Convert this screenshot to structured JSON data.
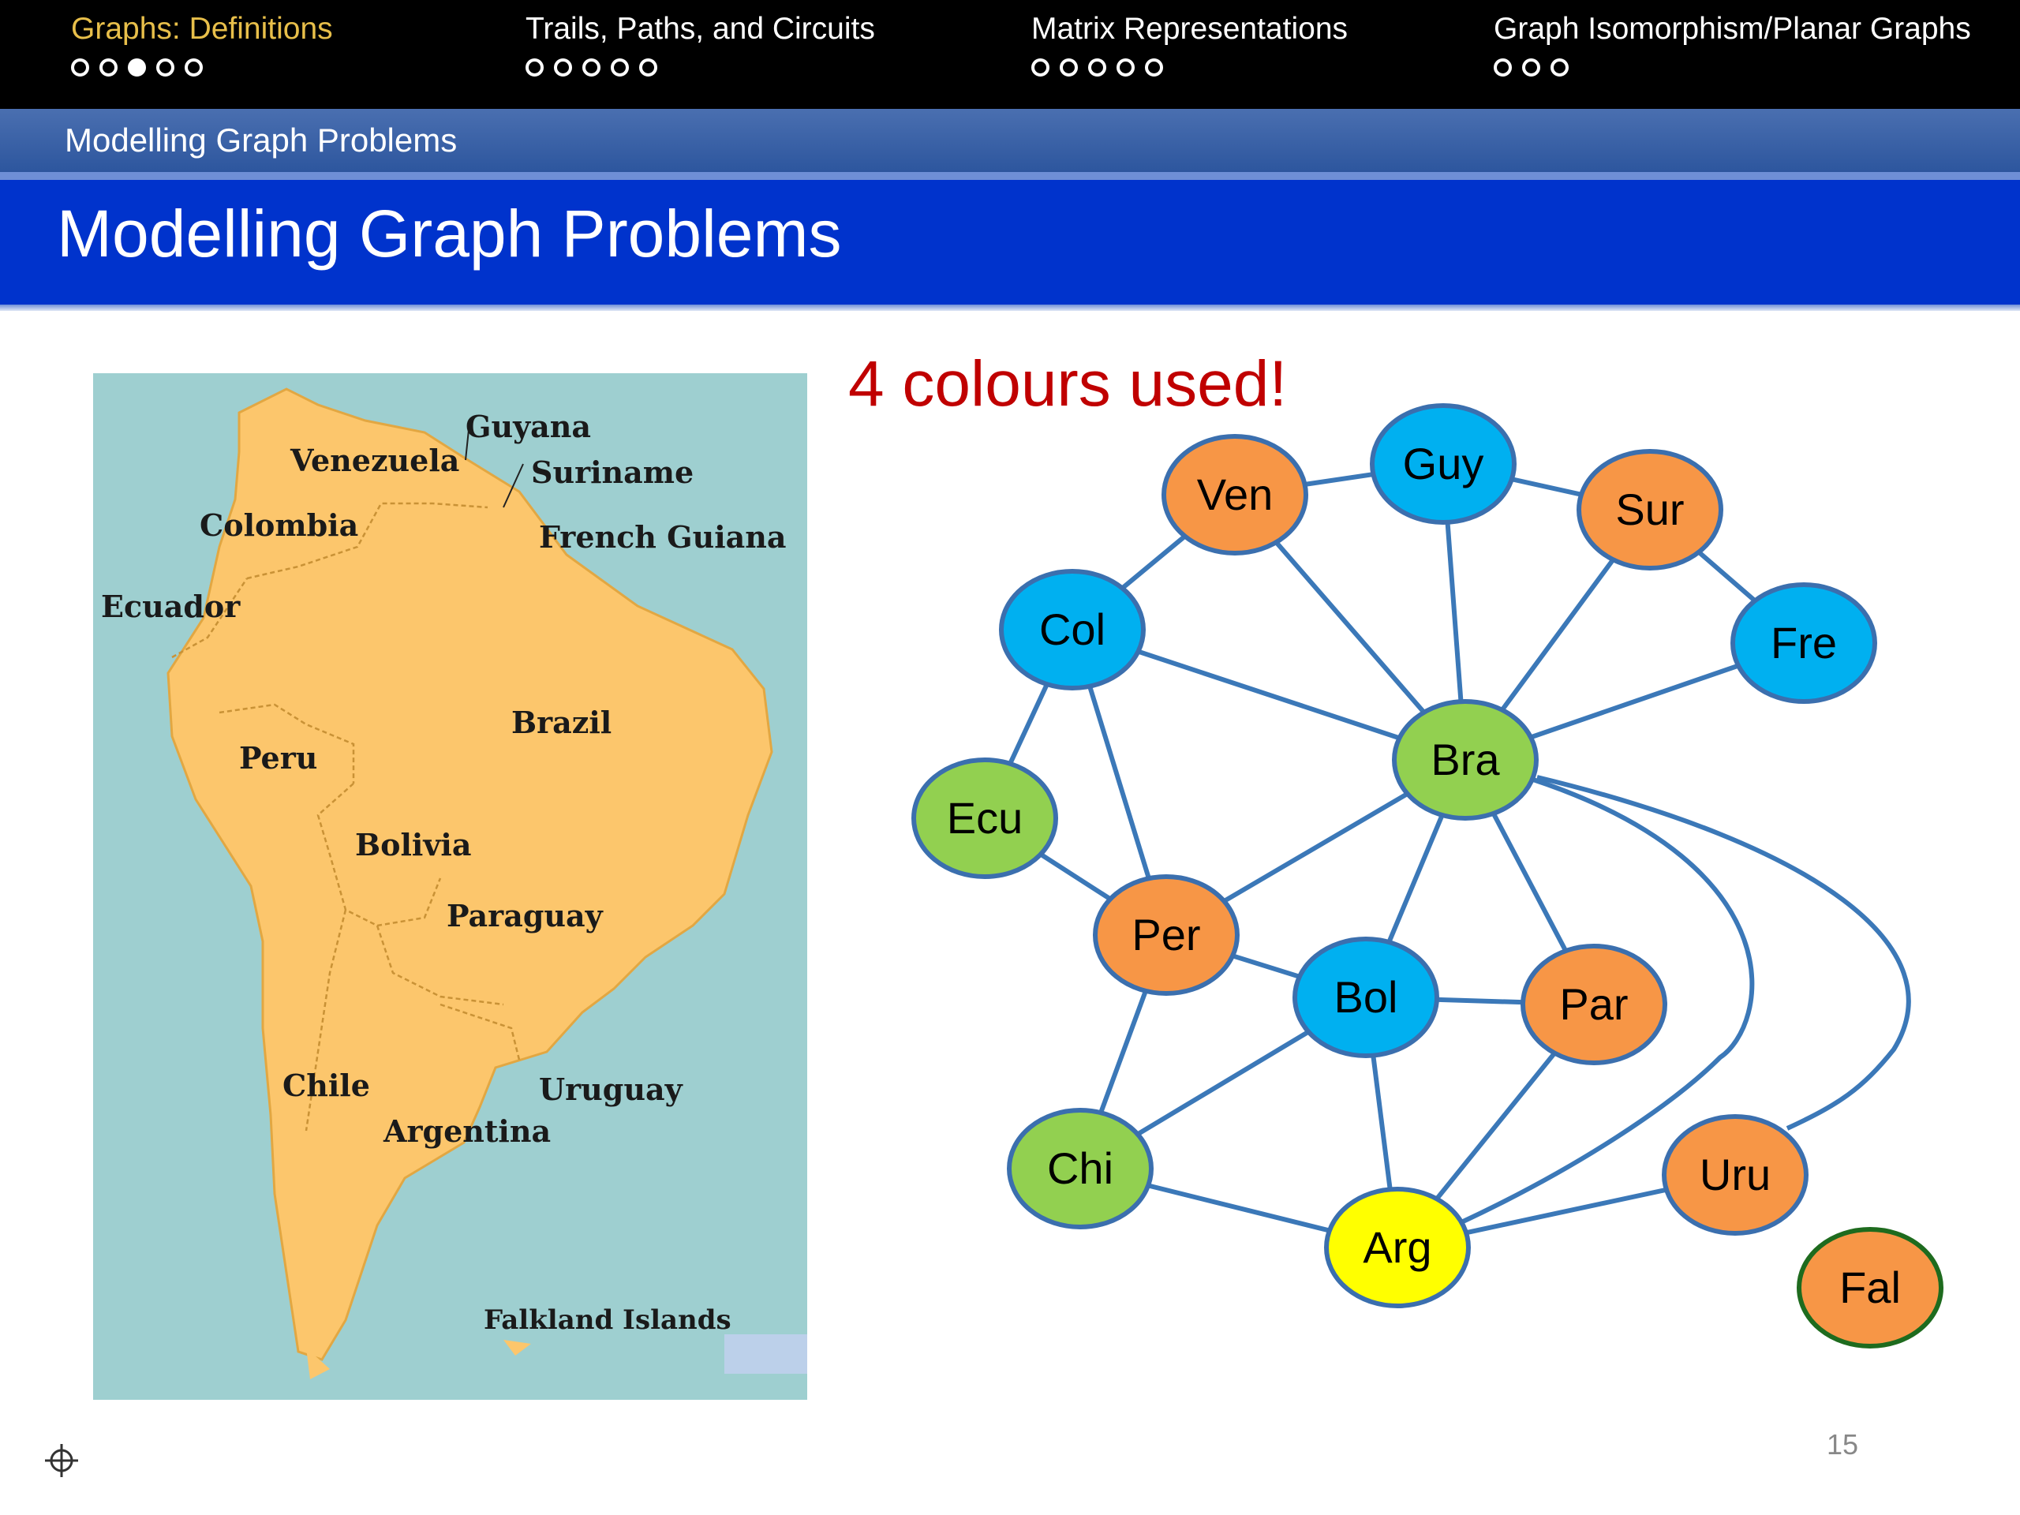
{
  "nav": {
    "sections": [
      {
        "title": "Graphs: Definitions",
        "dots": [
          false,
          false,
          true,
          false,
          false
        ],
        "active": true
      },
      {
        "title": "Trails, Paths, and Circuits",
        "dots": [
          false,
          false,
          false,
          false,
          false
        ],
        "active": false
      },
      {
        "title": "Matrix Representations",
        "dots": [
          false,
          false,
          false,
          false,
          false
        ],
        "active": false
      },
      {
        "title": "Graph Isomorphism/Planar Graphs",
        "dots": [
          false,
          false,
          false
        ],
        "active": false
      }
    ]
  },
  "subtitle": "Modelling Graph Problems",
  "title": "Modelling Graph Problems",
  "caption": "4 colours used!",
  "map": {
    "labels": {
      "guyana": "Guyana",
      "venezuela": "Venezuela",
      "suriname": "Suriname",
      "colombia": "Colombia",
      "french_guiana": "French Guiana",
      "ecuador": "Ecuador",
      "brazil": "Brazil",
      "peru": "Peru",
      "bolivia": "Bolivia",
      "paraguay": "Paraguay",
      "chile": "Chile",
      "uruguay": "Uruguay",
      "argentina": "Argentina",
      "falkland": "Falkland Islands"
    }
  },
  "graph": {
    "colors": {
      "orange": "#f79646",
      "blue": "#00b0f0",
      "green": "#92d050",
      "yellow": "#ffff00",
      "edge": "#3b78b8",
      "outline": "#3b6fae",
      "outline_fal": "#1e6b1e"
    },
    "nodes": [
      {
        "id": "ven",
        "label": "Ven",
        "color": "orange"
      },
      {
        "id": "guy",
        "label": "Guy",
        "color": "blue"
      },
      {
        "id": "sur",
        "label": "Sur",
        "color": "orange"
      },
      {
        "id": "col",
        "label": "Col",
        "color": "blue"
      },
      {
        "id": "fre",
        "label": "Fre",
        "color": "blue"
      },
      {
        "id": "bra",
        "label": "Bra",
        "color": "green"
      },
      {
        "id": "ecu",
        "label": "Ecu",
        "color": "green"
      },
      {
        "id": "per",
        "label": "Per",
        "color": "orange"
      },
      {
        "id": "bol",
        "label": "Bol",
        "color": "blue"
      },
      {
        "id": "par",
        "label": "Par",
        "color": "orange"
      },
      {
        "id": "chi",
        "label": "Chi",
        "color": "green"
      },
      {
        "id": "uru",
        "label": "Uru",
        "color": "orange"
      },
      {
        "id": "arg",
        "label": "Arg",
        "color": "yellow"
      },
      {
        "id": "fal",
        "label": "Fal",
        "color": "orange"
      }
    ],
    "edges": [
      [
        "ven",
        "guy"
      ],
      [
        "guy",
        "sur"
      ],
      [
        "sur",
        "fre"
      ],
      [
        "ven",
        "col"
      ],
      [
        "ven",
        "bra"
      ],
      [
        "guy",
        "bra"
      ],
      [
        "sur",
        "bra"
      ],
      [
        "fre",
        "bra"
      ],
      [
        "col",
        "bra"
      ],
      [
        "col",
        "ecu"
      ],
      [
        "col",
        "per"
      ],
      [
        "ecu",
        "per"
      ],
      [
        "per",
        "bra"
      ],
      [
        "per",
        "bol"
      ],
      [
        "per",
        "chi"
      ],
      [
        "bol",
        "bra"
      ],
      [
        "par",
        "bra"
      ],
      [
        "bol",
        "par"
      ],
      [
        "bol",
        "chi"
      ],
      [
        "bol",
        "arg"
      ],
      [
        "par",
        "arg"
      ],
      [
        "chi",
        "arg"
      ],
      [
        "arg",
        "uru"
      ],
      [
        "bra",
        "arg"
      ],
      [
        "bra",
        "uru"
      ]
    ]
  },
  "page_number": "15"
}
